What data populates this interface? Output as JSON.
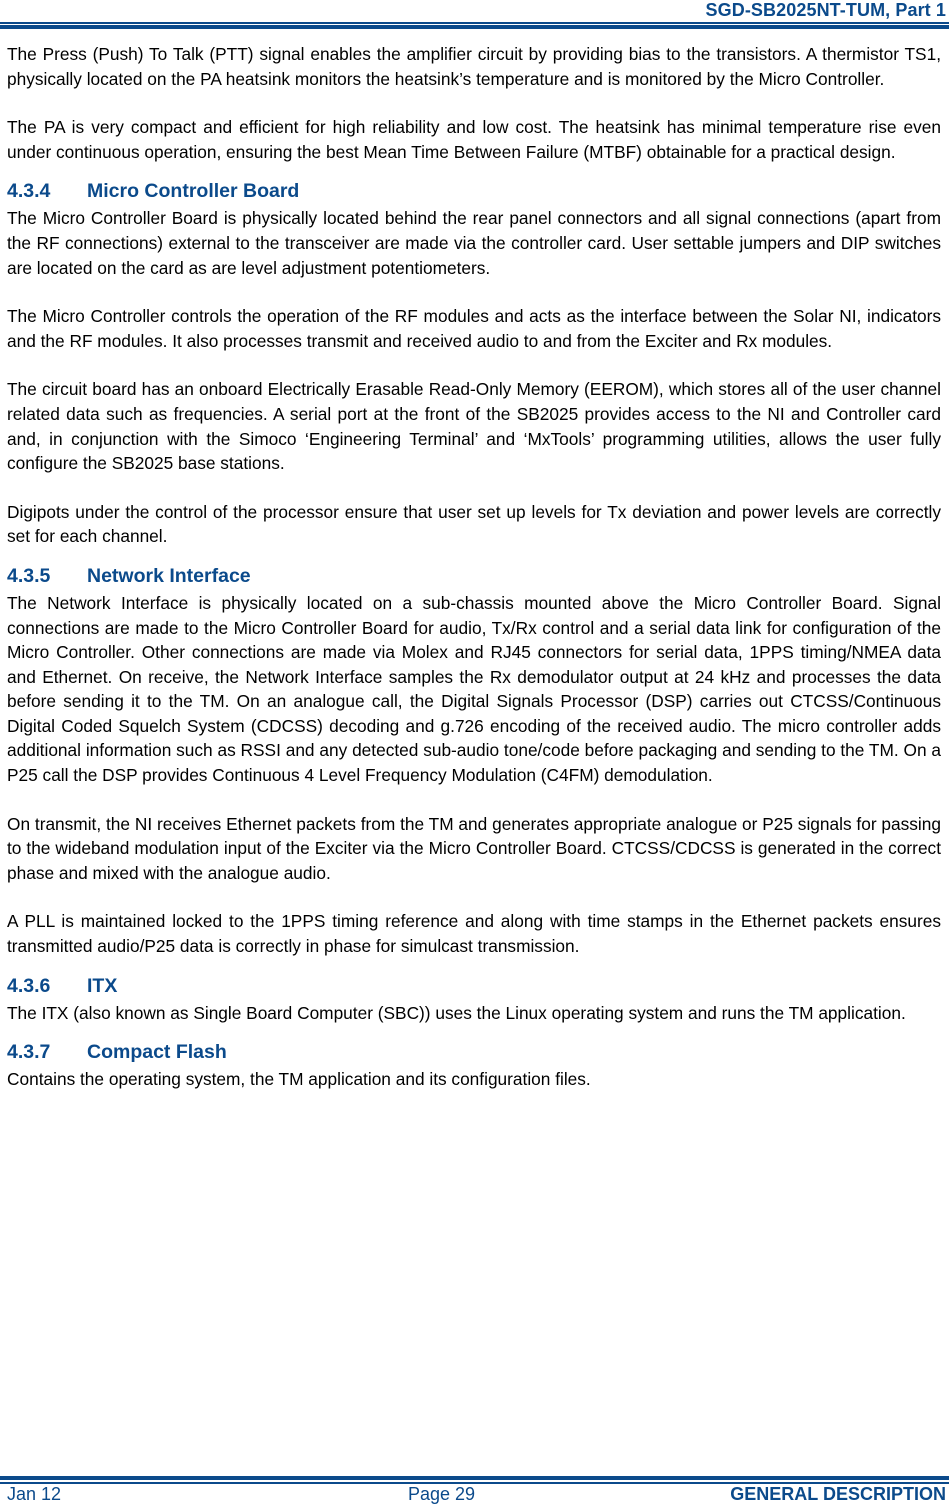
{
  "header": {
    "doc_title": "SGD-SB2025NT-TUM, Part 1"
  },
  "colors": {
    "accent": "#0b4a8b"
  },
  "blocks": [
    {
      "type": "p",
      "text": "The Press (Push) To Talk (PTT) signal enables the amplifier circuit by providing bias to the transistors.  A thermistor TS1, physically located on the PA heatsink monitors the heatsink’s temperature and is monitored by the Micro Controller."
    },
    {
      "type": "p",
      "text": "The PA is very compact and efficient for high reliability and low cost.  The heatsink has minimal temperature rise even under continuous operation, ensuring the best Mean Time Between Failure (MTBF) obtainable for a practical design."
    },
    {
      "type": "h",
      "num": "4.3.4",
      "title": "Micro Controller Board"
    },
    {
      "type": "p",
      "text": "The Micro Controller Board is physically located behind the rear panel connectors and all signal connections (apart from the RF connections) external to the transceiver are made via the controller card.  User settable jumpers and DIP switches are located on the card as are level adjustment potentiometers."
    },
    {
      "type": "p",
      "text": "The Micro Controller controls the operation of the RF modules and acts as the interface between the Solar NI, indicators and the RF modules.  It also processes transmit and received audio to and from the Exciter and Rx modules."
    },
    {
      "type": "p",
      "text": "The circuit board has an onboard Electrically Erasable Read-Only Memory (EEROM), which stores all of the user channel related data such as frequencies.  A serial port at the front of the SB2025 provides access to the NI and Controller card and, in conjunction with the Simoco ‘Engineering Terminal’ and ‘MxTools’ programming utilities, allows the user fully configure the SB2025 base stations."
    },
    {
      "type": "p",
      "text": "Digipots under the control of the processor ensure that user set up levels for Tx deviation and power levels are correctly set for each channel."
    },
    {
      "type": "h",
      "num": "4.3.5",
      "title": "Network Interface"
    },
    {
      "type": "p",
      "text": "The Network Interface is physically located on a sub-chassis mounted above the Micro Controller Board.  Signal connections are made to the Micro Controller Board for audio, Tx/Rx control and a serial data link for configuration of the Micro Controller.  Other connections are made via Molex and RJ45 connectors for serial data, 1PPS timing/NMEA data and Ethernet.  On receive, the Network Interface samples the Rx demodulator output at 24 kHz and processes the data before sending it to the TM.  On an analogue call, the Digital Signals Processor (DSP) carries out CTCSS/Continuous Digital Coded Squelch System (CDCSS) decoding and g.726 encoding of the received audio.  The micro controller adds additional information such as RSSI and any detected sub-audio tone/code before packaging and sending to the TM.  On a P25 call the DSP provides Continuous 4 Level Frequency Modulation (C4FM) demodulation."
    },
    {
      "type": "p",
      "text": "On transmit, the NI receives Ethernet packets from the TM and generates appropriate analogue or P25 signals for passing to the wideband modulation input of the Exciter via the Micro Controller Board.  CTCSS/CDCSS is generated in the correct phase and mixed with the analogue audio."
    },
    {
      "type": "p",
      "text": "A PLL is maintained locked to the 1PPS timing reference and along with time stamps in the Ethernet packets ensures transmitted audio/P25 data is correctly in phase for simulcast transmission."
    },
    {
      "type": "h",
      "num": "4.3.6",
      "title": "ITX"
    },
    {
      "type": "p",
      "text": "The ITX (also known as Single Board Computer (SBC)) uses the Linux operating system and runs the TM application."
    },
    {
      "type": "h",
      "num": "4.3.7",
      "title": "Compact Flash"
    },
    {
      "type": "p",
      "text": "Contains the operating system, the TM application and its configuration files."
    }
  ],
  "footer": {
    "date": "Jan 12",
    "page": "Page 29",
    "section": "GENERAL DESCRIPTION"
  }
}
